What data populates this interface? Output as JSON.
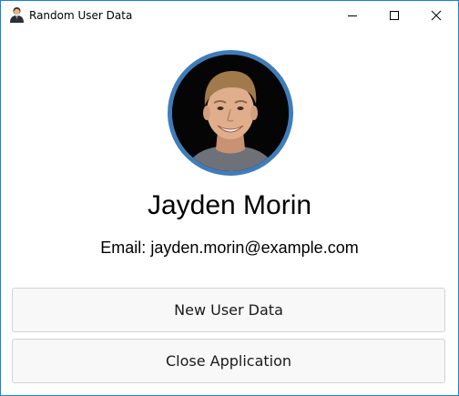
{
  "window": {
    "title": "Random User Data",
    "controls": {
      "minimize": "minimize-icon",
      "maximize": "maximize-icon",
      "close": "close-icon"
    }
  },
  "user": {
    "name": "Jayden Morin",
    "email_label": "Email:",
    "email": "jayden.morin@example.com"
  },
  "buttons": {
    "new_user": "New User Data",
    "close_app": "Close Application"
  },
  "colors": {
    "avatar_ring": "#3f7dba",
    "window_border": "#1883d7"
  }
}
